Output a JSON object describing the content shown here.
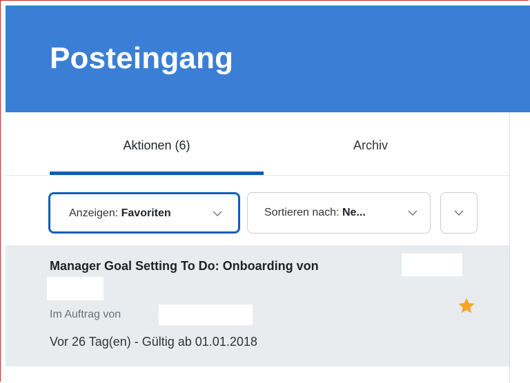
{
  "header": {
    "title": "Posteingang"
  },
  "tabs": [
    {
      "label": "Aktionen (6)",
      "active": true
    },
    {
      "label": "Archiv",
      "active": false
    }
  ],
  "filters": {
    "show": {
      "label": "Anzeigen:",
      "value": "Favoriten"
    },
    "sort": {
      "label": "Sortieren nach:",
      "value": "Ne..."
    }
  },
  "item": {
    "title": "Manager Goal Setting To Do: Onboarding von",
    "subtitle": "Im Auftrag von",
    "meta": "Vor 26 Tag(en) - Gültig ab 01.01.2018",
    "starred": true
  },
  "colors": {
    "header": "#3a7fd5",
    "accent": "#0b5cb8",
    "star": "#f5a623",
    "item_bg": "#e8ecef"
  }
}
